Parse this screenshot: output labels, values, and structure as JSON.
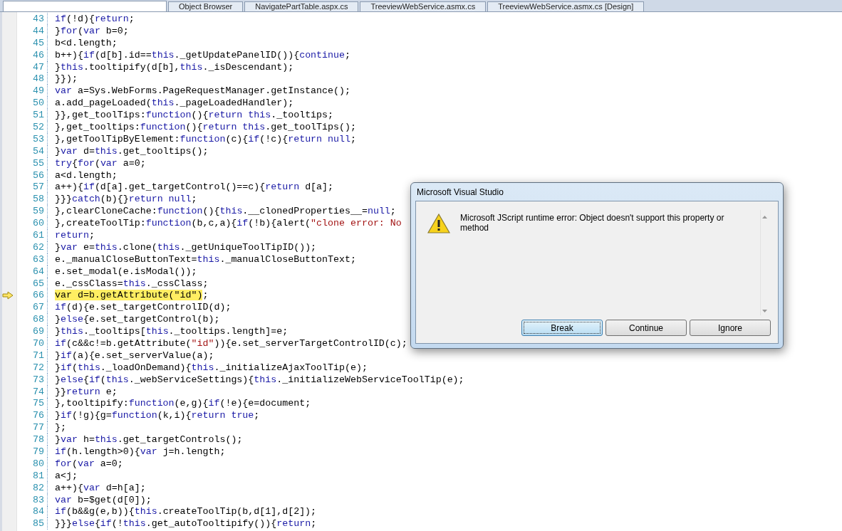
{
  "tabs": [
    {
      "label": "Object Browser",
      "selected": false
    },
    {
      "label": "NavigatePartTable.aspx.cs",
      "selected": false
    },
    {
      "label": "TreeviewWebService.asmx.cs",
      "selected": false
    },
    {
      "label": "TreeviewWebService.asmx.cs [Design]",
      "selected": false
    }
  ],
  "code": {
    "lines": [
      {
        "number": "43",
        "current": false,
        "tokens": [
          {
            "kind": "kw",
            "text": "if"
          },
          {
            "kind": "tx",
            "text": "(!d){"
          },
          {
            "kind": "kw",
            "text": "return"
          },
          {
            "kind": "tx",
            "text": ";"
          }
        ]
      },
      {
        "number": "44",
        "current": false,
        "tokens": [
          {
            "kind": "tx",
            "text": "}"
          },
          {
            "kind": "kw",
            "text": "for"
          },
          {
            "kind": "tx",
            "text": "("
          },
          {
            "kind": "kw",
            "text": "var"
          },
          {
            "kind": "tx",
            "text": " b=0;"
          }
        ]
      },
      {
        "number": "45",
        "current": false,
        "tokens": [
          {
            "kind": "tx",
            "text": "b<d.length;"
          }
        ]
      },
      {
        "number": "46",
        "current": false,
        "tokens": [
          {
            "kind": "tx",
            "text": "b++){"
          },
          {
            "kind": "kw",
            "text": "if"
          },
          {
            "kind": "tx",
            "text": "(d[b].id=="
          },
          {
            "kind": "kw",
            "text": "this"
          },
          {
            "kind": "tx",
            "text": "._getUpdatePanelID()){"
          },
          {
            "kind": "kw",
            "text": "continue"
          },
          {
            "kind": "tx",
            "text": ";"
          }
        ]
      },
      {
        "number": "47",
        "current": false,
        "tokens": [
          {
            "kind": "tx",
            "text": "}"
          },
          {
            "kind": "kw",
            "text": "this"
          },
          {
            "kind": "tx",
            "text": ".tooltipify(d[b],"
          },
          {
            "kind": "kw",
            "text": "this"
          },
          {
            "kind": "tx",
            "text": "._isDescendant);"
          }
        ]
      },
      {
        "number": "48",
        "current": false,
        "tokens": [
          {
            "kind": "tx",
            "text": "}});"
          }
        ]
      },
      {
        "number": "49",
        "current": false,
        "tokens": [
          {
            "kind": "kw",
            "text": "var"
          },
          {
            "kind": "tx",
            "text": " a=Sys.WebForms.PageRequestManager.getInstance();"
          }
        ]
      },
      {
        "number": "50",
        "current": false,
        "tokens": [
          {
            "kind": "tx",
            "text": "a.add_pageLoaded("
          },
          {
            "kind": "kw",
            "text": "this"
          },
          {
            "kind": "tx",
            "text": "._pageLoadedHandler);"
          }
        ]
      },
      {
        "number": "51",
        "current": false,
        "tokens": [
          {
            "kind": "tx",
            "text": "}},get_toolTips:"
          },
          {
            "kind": "kw",
            "text": "function"
          },
          {
            "kind": "tx",
            "text": "(){"
          },
          {
            "kind": "kw",
            "text": "return this"
          },
          {
            "kind": "tx",
            "text": "._tooltips;"
          }
        ]
      },
      {
        "number": "52",
        "current": false,
        "tokens": [
          {
            "kind": "tx",
            "text": "},get_tooltips:"
          },
          {
            "kind": "kw",
            "text": "function"
          },
          {
            "kind": "tx",
            "text": "(){"
          },
          {
            "kind": "kw",
            "text": "return this"
          },
          {
            "kind": "tx",
            "text": ".get_toolTips();"
          }
        ]
      },
      {
        "number": "53",
        "current": false,
        "tokens": [
          {
            "kind": "tx",
            "text": "},getToolTipByElement:"
          },
          {
            "kind": "kw",
            "text": "function"
          },
          {
            "kind": "tx",
            "text": "(c){"
          },
          {
            "kind": "kw",
            "text": "if"
          },
          {
            "kind": "tx",
            "text": "(!c){"
          },
          {
            "kind": "kw",
            "text": "return null"
          },
          {
            "kind": "tx",
            "text": ";"
          }
        ]
      },
      {
        "number": "54",
        "current": false,
        "tokens": [
          {
            "kind": "tx",
            "text": "}"
          },
          {
            "kind": "kw",
            "text": "var"
          },
          {
            "kind": "tx",
            "text": " d="
          },
          {
            "kind": "kw",
            "text": "this"
          },
          {
            "kind": "tx",
            "text": ".get_tooltips();"
          }
        ]
      },
      {
        "number": "55",
        "current": false,
        "tokens": [
          {
            "kind": "kw",
            "text": "try"
          },
          {
            "kind": "tx",
            "text": "{"
          },
          {
            "kind": "kw",
            "text": "for"
          },
          {
            "kind": "tx",
            "text": "("
          },
          {
            "kind": "kw",
            "text": "var"
          },
          {
            "kind": "tx",
            "text": " a=0;"
          }
        ]
      },
      {
        "number": "56",
        "current": false,
        "tokens": [
          {
            "kind": "tx",
            "text": "a<d.length;"
          }
        ]
      },
      {
        "number": "57",
        "current": false,
        "tokens": [
          {
            "kind": "tx",
            "text": "a++){"
          },
          {
            "kind": "kw",
            "text": "if"
          },
          {
            "kind": "tx",
            "text": "(d[a].get_targetControl()==c){"
          },
          {
            "kind": "kw",
            "text": "return"
          },
          {
            "kind": "tx",
            "text": " d[a];"
          }
        ]
      },
      {
        "number": "58",
        "current": false,
        "tokens": [
          {
            "kind": "tx",
            "text": "}}}"
          },
          {
            "kind": "kw",
            "text": "catch"
          },
          {
            "kind": "tx",
            "text": "(b){}"
          },
          {
            "kind": "kw",
            "text": "return null"
          },
          {
            "kind": "tx",
            "text": ";"
          }
        ]
      },
      {
        "number": "59",
        "current": false,
        "tokens": [
          {
            "kind": "tx",
            "text": "},clearCloneCache:"
          },
          {
            "kind": "kw",
            "text": "function"
          },
          {
            "kind": "tx",
            "text": "(){"
          },
          {
            "kind": "kw",
            "text": "this"
          },
          {
            "kind": "tx",
            "text": ".__clonedProperties__="
          },
          {
            "kind": "kw",
            "text": "null"
          },
          {
            "kind": "tx",
            "text": ";"
          }
        ]
      },
      {
        "number": "60",
        "current": false,
        "tokens": [
          {
            "kind": "tx",
            "text": "},createToolTip:"
          },
          {
            "kind": "kw",
            "text": "function"
          },
          {
            "kind": "tx",
            "text": "(b,c,a){"
          },
          {
            "kind": "kw",
            "text": "if"
          },
          {
            "kind": "tx",
            "text": "(!b){alert("
          },
          {
            "kind": "st",
            "text": "\"clone error: No"
          }
        ]
      },
      {
        "number": "61",
        "current": false,
        "tokens": [
          {
            "kind": "kw",
            "text": "return"
          },
          {
            "kind": "tx",
            "text": ";"
          }
        ]
      },
      {
        "number": "62",
        "current": false,
        "tokens": [
          {
            "kind": "tx",
            "text": "}"
          },
          {
            "kind": "kw",
            "text": "var"
          },
          {
            "kind": "tx",
            "text": " e="
          },
          {
            "kind": "kw",
            "text": "this"
          },
          {
            "kind": "tx",
            "text": ".clone("
          },
          {
            "kind": "kw",
            "text": "this"
          },
          {
            "kind": "tx",
            "text": "._getUniqueToolTipID());"
          }
        ]
      },
      {
        "number": "63",
        "current": false,
        "tokens": [
          {
            "kind": "tx",
            "text": "e._manualCloseButtonText="
          },
          {
            "kind": "kw",
            "text": "this"
          },
          {
            "kind": "tx",
            "text": "._manualCloseButtonText;"
          }
        ]
      },
      {
        "number": "64",
        "current": false,
        "tokens": [
          {
            "kind": "tx",
            "text": "e.set_modal(e.isModal());"
          }
        ]
      },
      {
        "number": "65",
        "current": false,
        "tokens": [
          {
            "kind": "tx",
            "text": "e._cssClass="
          },
          {
            "kind": "kw",
            "text": "this"
          },
          {
            "kind": "tx",
            "text": "._cssClass;"
          }
        ]
      },
      {
        "number": "66",
        "current": true,
        "tokens": [
          {
            "kind": "tx",
            "text": "var d=b.getAttribute(\"id\")"
          },
          {
            "kind": "tx",
            "text": ";"
          }
        ]
      },
      {
        "number": "67",
        "current": false,
        "tokens": [
          {
            "kind": "kw",
            "text": "if"
          },
          {
            "kind": "tx",
            "text": "(d){e.set_targetControlID(d);"
          }
        ]
      },
      {
        "number": "68",
        "current": false,
        "tokens": [
          {
            "kind": "tx",
            "text": "}"
          },
          {
            "kind": "kw",
            "text": "else"
          },
          {
            "kind": "tx",
            "text": "{e.set_targetControl(b);"
          }
        ]
      },
      {
        "number": "69",
        "current": false,
        "tokens": [
          {
            "kind": "tx",
            "text": "}"
          },
          {
            "kind": "kw",
            "text": "this"
          },
          {
            "kind": "tx",
            "text": "._tooltips["
          },
          {
            "kind": "kw",
            "text": "this"
          },
          {
            "kind": "tx",
            "text": "._tooltips.length]=e;"
          }
        ]
      },
      {
        "number": "70",
        "current": false,
        "tokens": [
          {
            "kind": "kw",
            "text": "if"
          },
          {
            "kind": "tx",
            "text": "(c&&c!=b.getAttribute("
          },
          {
            "kind": "st",
            "text": "\"id\""
          },
          {
            "kind": "tx",
            "text": ")){e.set_serverTargetControlID(c);"
          }
        ]
      },
      {
        "number": "71",
        "current": false,
        "tokens": [
          {
            "kind": "tx",
            "text": "}"
          },
          {
            "kind": "kw",
            "text": "if"
          },
          {
            "kind": "tx",
            "text": "(a){e.set_serverValue(a);"
          }
        ]
      },
      {
        "number": "72",
        "current": false,
        "tokens": [
          {
            "kind": "tx",
            "text": "}"
          },
          {
            "kind": "kw",
            "text": "if"
          },
          {
            "kind": "tx",
            "text": "("
          },
          {
            "kind": "kw",
            "text": "this"
          },
          {
            "kind": "tx",
            "text": "._loadOnDemand){"
          },
          {
            "kind": "kw",
            "text": "this"
          },
          {
            "kind": "tx",
            "text": "._initializeAjaxToolTip(e);"
          }
        ]
      },
      {
        "number": "73",
        "current": false,
        "tokens": [
          {
            "kind": "tx",
            "text": "}"
          },
          {
            "kind": "kw",
            "text": "else"
          },
          {
            "kind": "tx",
            "text": "{"
          },
          {
            "kind": "kw",
            "text": "if"
          },
          {
            "kind": "tx",
            "text": "("
          },
          {
            "kind": "kw",
            "text": "this"
          },
          {
            "kind": "tx",
            "text": "._webServiceSettings){"
          },
          {
            "kind": "kw",
            "text": "this"
          },
          {
            "kind": "tx",
            "text": "._initializeWebServiceToolTip(e);"
          }
        ]
      },
      {
        "number": "74",
        "current": false,
        "tokens": [
          {
            "kind": "tx",
            "text": "}}"
          },
          {
            "kind": "kw",
            "text": "return"
          },
          {
            "kind": "tx",
            "text": " e;"
          }
        ]
      },
      {
        "number": "75",
        "current": false,
        "tokens": [
          {
            "kind": "tx",
            "text": "},tooltipify:"
          },
          {
            "kind": "kw",
            "text": "function"
          },
          {
            "kind": "tx",
            "text": "(e,g){"
          },
          {
            "kind": "kw",
            "text": "if"
          },
          {
            "kind": "tx",
            "text": "(!e){e=document;"
          }
        ]
      },
      {
        "number": "76",
        "current": false,
        "tokens": [
          {
            "kind": "tx",
            "text": "}"
          },
          {
            "kind": "kw",
            "text": "if"
          },
          {
            "kind": "tx",
            "text": "(!g){g="
          },
          {
            "kind": "kw",
            "text": "function"
          },
          {
            "kind": "tx",
            "text": "(k,i){"
          },
          {
            "kind": "kw",
            "text": "return true"
          },
          {
            "kind": "tx",
            "text": ";"
          }
        ]
      },
      {
        "number": "77",
        "current": false,
        "tokens": [
          {
            "kind": "tx",
            "text": "};"
          }
        ]
      },
      {
        "number": "78",
        "current": false,
        "tokens": [
          {
            "kind": "tx",
            "text": "}"
          },
          {
            "kind": "kw",
            "text": "var"
          },
          {
            "kind": "tx",
            "text": " h="
          },
          {
            "kind": "kw",
            "text": "this"
          },
          {
            "kind": "tx",
            "text": ".get_targetControls();"
          }
        ]
      },
      {
        "number": "79",
        "current": false,
        "tokens": [
          {
            "kind": "kw",
            "text": "if"
          },
          {
            "kind": "tx",
            "text": "(h.length>0){"
          },
          {
            "kind": "kw",
            "text": "var"
          },
          {
            "kind": "tx",
            "text": " j=h.length;"
          }
        ]
      },
      {
        "number": "80",
        "current": false,
        "tokens": [
          {
            "kind": "kw",
            "text": "for"
          },
          {
            "kind": "tx",
            "text": "("
          },
          {
            "kind": "kw",
            "text": "var"
          },
          {
            "kind": "tx",
            "text": " a=0;"
          }
        ]
      },
      {
        "number": "81",
        "current": false,
        "tokens": [
          {
            "kind": "tx",
            "text": "a<j;"
          }
        ]
      },
      {
        "number": "82",
        "current": false,
        "tokens": [
          {
            "kind": "tx",
            "text": "a++){"
          },
          {
            "kind": "kw",
            "text": "var"
          },
          {
            "kind": "tx",
            "text": " d=h[a];"
          }
        ]
      },
      {
        "number": "83",
        "current": false,
        "tokens": [
          {
            "kind": "kw",
            "text": "var"
          },
          {
            "kind": "tx",
            "text": " b=$get(d[0]);"
          }
        ]
      },
      {
        "number": "84",
        "current": false,
        "tokens": [
          {
            "kind": "kw",
            "text": "if"
          },
          {
            "kind": "tx",
            "text": "(b&&g(e,b)){"
          },
          {
            "kind": "kw",
            "text": "this"
          },
          {
            "kind": "tx",
            "text": ".createToolTip(b,d[1],d[2]);"
          }
        ]
      },
      {
        "number": "85",
        "current": false,
        "tokens": [
          {
            "kind": "tx",
            "text": "}}}"
          },
          {
            "kind": "kw",
            "text": "else"
          },
          {
            "kind": "tx",
            "text": "{"
          },
          {
            "kind": "kw",
            "text": "if"
          },
          {
            "kind": "tx",
            "text": "(!"
          },
          {
            "kind": "kw",
            "text": "this"
          },
          {
            "kind": "tx",
            "text": ".get_autoTooltipify()){"
          },
          {
            "kind": "kw",
            "text": "return"
          },
          {
            "kind": "tx",
            "text": ";"
          }
        ]
      }
    ]
  },
  "dialog": {
    "title": "Microsoft Visual Studio",
    "message": "Microsoft JScript runtime error: Object doesn't support this property or method",
    "buttons": [
      {
        "label": "Break",
        "selected": true
      },
      {
        "label": "Continue",
        "selected": false
      },
      {
        "label": "Ignore",
        "selected": false
      }
    ]
  }
}
